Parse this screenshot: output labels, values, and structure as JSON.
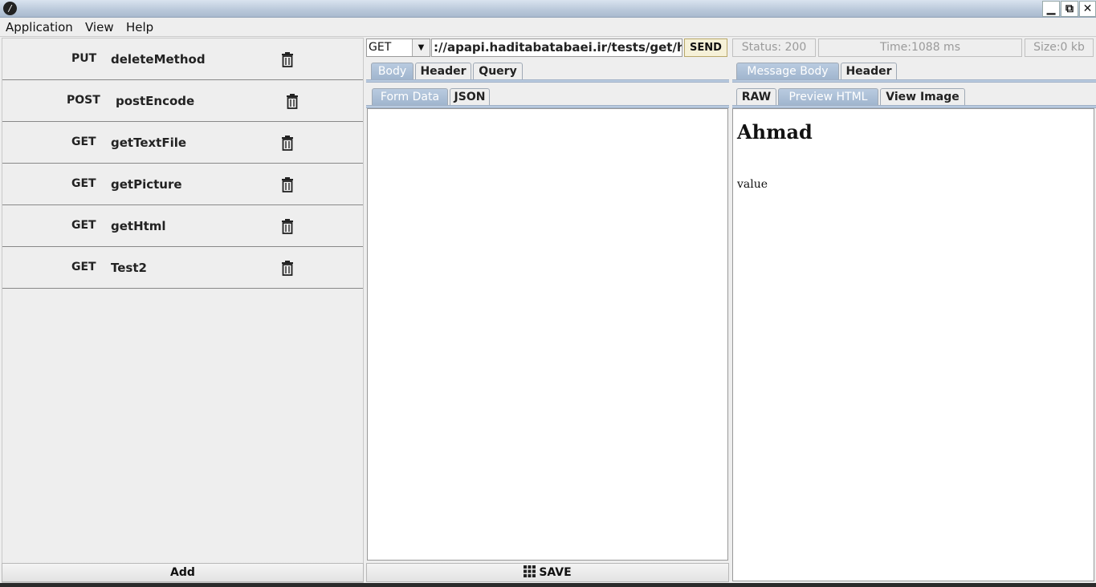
{
  "window": {
    "icon": "app-logo-icon",
    "controls": {
      "minimize": "▁",
      "maximize": "⧉",
      "close": "✕"
    }
  },
  "menu": {
    "items": [
      {
        "label": "Application"
      },
      {
        "label": "View"
      },
      {
        "label": "Help"
      }
    ]
  },
  "requests": {
    "items": [
      {
        "method": "PUT",
        "name": "deleteMethod"
      },
      {
        "method": "POST",
        "name": "postEncode"
      },
      {
        "method": "GET",
        "name": "getTextFile"
      },
      {
        "method": "GET",
        "name": "getPicture"
      },
      {
        "method": "GET",
        "name": "getHtml"
      },
      {
        "method": "GET",
        "name": "Test2"
      }
    ],
    "add_label": "Add"
  },
  "request": {
    "method": "GET",
    "url": "://apapi.haditabatabaei.ir/tests/get/html",
    "send_label": "SEND",
    "tabs": [
      "Body",
      "Header",
      "Query"
    ],
    "active_tab": "Body",
    "body_tabs": [
      "Form Data",
      "JSON"
    ],
    "active_body_tab": "Form Data",
    "save_label": "SAVE"
  },
  "response": {
    "status": "Status: 200",
    "time": "Time:1088 ms",
    "size": "Size:0 kb",
    "tabs": [
      "Message Body",
      "Header"
    ],
    "active_tab": "Message Body",
    "view_tabs": [
      "RAW",
      "Preview HTML",
      "View Image"
    ],
    "active_view_tab": "Preview HTML",
    "preview": {
      "heading": "Ahmad",
      "text": "value"
    }
  },
  "colors": {
    "active_tab": "#9fb4cd",
    "send_button": "#f6f1d8"
  }
}
